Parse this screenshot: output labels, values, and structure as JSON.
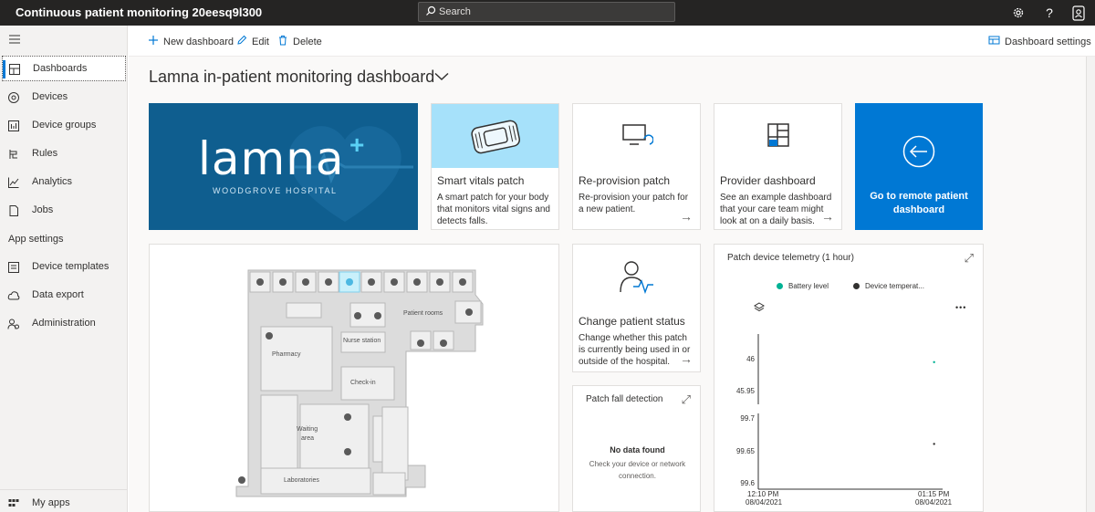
{
  "app": {
    "title": "Continuous patient monitoring 20eesq9l300",
    "search_placeholder": "Search"
  },
  "topbar_icons": [
    "gear-icon",
    "help-icon",
    "account-icon"
  ],
  "sidebar": {
    "items": [
      {
        "label": "Dashboards",
        "icon": "dashboard-icon",
        "active": true
      },
      {
        "label": "Devices",
        "icon": "device-icon"
      },
      {
        "label": "Device groups",
        "icon": "device-groups-icon"
      },
      {
        "label": "Rules",
        "icon": "rules-icon"
      },
      {
        "label": "Analytics",
        "icon": "analytics-icon"
      },
      {
        "label": "Jobs",
        "icon": "jobs-icon"
      }
    ],
    "section_label": "App settings",
    "settings_items": [
      {
        "label": "Device templates",
        "icon": "device-templates-icon"
      },
      {
        "label": "Data export",
        "icon": "data-export-icon"
      },
      {
        "label": "Administration",
        "icon": "administration-icon"
      }
    ],
    "footer_item": {
      "label": "My apps",
      "icon": "apps-grid-icon"
    }
  },
  "commands": {
    "new_dashboard": "New dashboard",
    "edit": "Edit",
    "delete": "Delete",
    "settings": "Dashboard settings"
  },
  "page": {
    "title": "Lamna in-patient monitoring dashboard"
  },
  "hero": {
    "logo_text": "lamna",
    "subtitle": "WOODGROVE HOSPITAL"
  },
  "tiles": [
    {
      "title": "Smart vitals patch",
      "desc": "A smart patch for your body that monitors vital signs and detects falls."
    },
    {
      "title": "Re-provision patch",
      "desc": "Re-provision your patch for a new patient."
    },
    {
      "title": "Provider dashboard",
      "desc": "See an example dashboard that your care team might look at on a daily basis."
    }
  ],
  "remote": {
    "label": "Go to remote patient dashboard"
  },
  "floor_plan": {
    "labels": {
      "patient_rooms": "Patient rooms",
      "nurse_station": "Nurse station",
      "pharmacy": "Pharmacy",
      "check_in": "Check-in",
      "waiting": "Waiting",
      "area": "area",
      "laboratories": "Laboratories"
    }
  },
  "change_status": {
    "title": "Change patient status",
    "desc": "Change whether this patch is currently being used in or outside of the hospital."
  },
  "fall_detection": {
    "title": "Patch fall detection",
    "no_data": "No data found",
    "hint": "Check your device or network connection."
  },
  "telemetry": {
    "title": "Patch device telemetry (1 hour)",
    "more": "•••"
  },
  "chart_data": {
    "type": "scatter",
    "series": [
      {
        "name": "Battery level",
        "color": "#00b294",
        "points": [
          {
            "x": "01:12 PM",
            "y": 45.99
          }
        ]
      },
      {
        "name": "Device temperat...",
        "color": "#323130",
        "points": [
          {
            "x": "01:12 PM",
            "y": 99.66
          }
        ]
      }
    ],
    "x_ticks": [
      {
        "time": "12:10 PM",
        "date": "08/04/2021"
      },
      {
        "time": "01:15 PM",
        "date": "08/04/2021"
      }
    ],
    "y_ticks_top": [
      "46",
      "45.95"
    ],
    "y_ticks_bottom": [
      "99.7",
      "99.65",
      "99.6"
    ],
    "ylim_top": [
      45.9,
      46.05
    ],
    "ylim_bottom": [
      99.6,
      99.7
    ]
  }
}
